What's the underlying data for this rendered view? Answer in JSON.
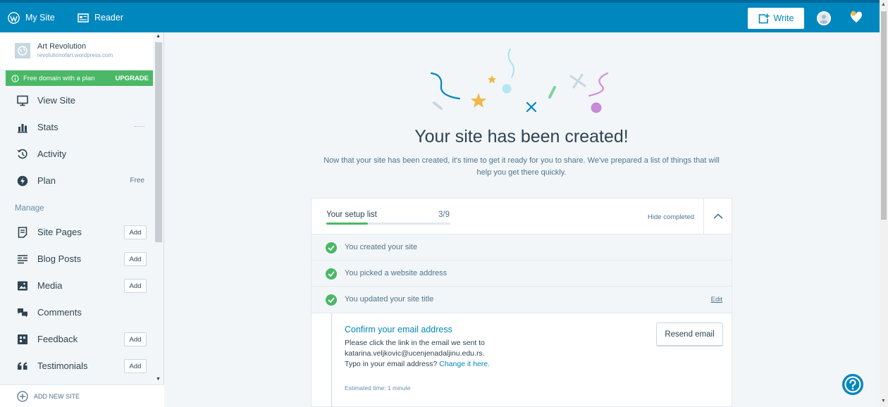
{
  "masterbar": {
    "my_site_label": "My Site",
    "reader_label": "Reader",
    "write_label": "Write",
    "avatar_icon": "user-avatar",
    "notifications_icon": "notification-bell-heart"
  },
  "sidebar": {
    "site_title": "Art Revolution",
    "site_url": "revolutionofart.wordpress.com",
    "promo_text": "Free domain with a plan",
    "promo_action": "UPGRADE",
    "items": [
      {
        "label": "View Site",
        "icon": "desktop-icon"
      },
      {
        "label": "Stats",
        "icon": "stats-icon"
      },
      {
        "label": "Activity",
        "icon": "activity-icon"
      },
      {
        "label": "Plan",
        "icon": "plan-icon",
        "extra": "Free"
      }
    ],
    "manage_label": "Manage",
    "manage_items": [
      {
        "label": "Site Pages",
        "icon": "pages-icon",
        "action": "Add"
      },
      {
        "label": "Blog Posts",
        "icon": "posts-icon",
        "action": "Add"
      },
      {
        "label": "Media",
        "icon": "media-icon",
        "action": "Add"
      },
      {
        "label": "Comments",
        "icon": "comments-icon"
      },
      {
        "label": "Feedback",
        "icon": "feedback-icon",
        "action": "Add"
      },
      {
        "label": "Testimonials",
        "icon": "quote-icon",
        "action": "Add"
      }
    ],
    "add_new_site": "ADD NEW SITE"
  },
  "main": {
    "headline": "Your site has been created!",
    "subtext_line1": "Now that your site has been created, it's time to get it ready for you to share. We've prepared a list of things that will",
    "subtext_line2": "help you get there quickly.",
    "checklist": {
      "title": "Your setup list",
      "count": "3/9",
      "progress": 0.333,
      "hide_completed": "Hide completed",
      "completed_tasks": [
        {
          "label": "You created your site"
        },
        {
          "label": "You picked a website address"
        },
        {
          "label": "You updated your site title",
          "action": "Edit"
        }
      ],
      "active_task": {
        "title": "Confirm your email address",
        "body_line1": "Please click the link in the email we sent to",
        "email": "katarina.veljkovic@ucenjenadaljinu.edu.rs.",
        "typo_text": "Typo in your email address?",
        "change_link": "Change it here.",
        "estimated_time": "Estimated time: 1 minute",
        "button": "Resend email"
      }
    }
  },
  "colors": {
    "brand_blue": "#0087be",
    "success_green": "#4ab866",
    "sidebar_bg": "#f3f6f8"
  }
}
